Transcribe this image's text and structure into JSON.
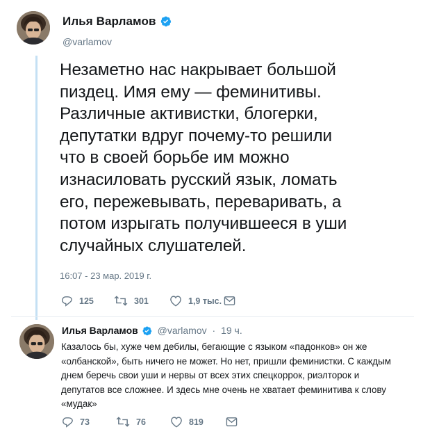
{
  "tweet": {
    "author_name": "Илья Варламов",
    "handle": "@varlamov",
    "text": "Незаметно нас накрывает большой\nпиздец. Имя ему — феминитивы.\nРазличные активистки, блогерки,\nдепутатки вдруг почему-то решили\nчто в своей борьбе им можно\nизнасиловать русский язык, ломать\nего, пережевывать, переваривать, а\nпотом изрыгать получившееся в уши\nслучайных слушателей.",
    "timestamp": "16:07 - 23 мар. 2019 г.",
    "replies": "125",
    "retweets": "301",
    "likes": "1,9 тыс."
  },
  "reply": {
    "author_name": "Илья Варламов",
    "handle": "@varlamov",
    "separator": "·",
    "time_ago": "19 ч.",
    "text": "Казалось бы, хуже чем дебилы, бегающие с языком «падонков» он же\n«олбанской», быть ничего не может. Но нет, пришли феминистки. С каждым\nднем беречь свои уши и нервы от всех этих спецкоррок, риэлторок и\nдепутатов все сложнее. И здесь мне очень не хватает феминитива к слову\n«мудак»",
    "replies": "73",
    "retweets": "76",
    "likes": "819"
  },
  "colors": {
    "text": "#14171a",
    "secondary": "#657786",
    "verified": "#1da1f2",
    "thread_line": "#c4e0f4"
  },
  "icons": [
    "reply-icon",
    "retweet-icon",
    "like-icon",
    "message-icon",
    "verified-badge-icon"
  ]
}
